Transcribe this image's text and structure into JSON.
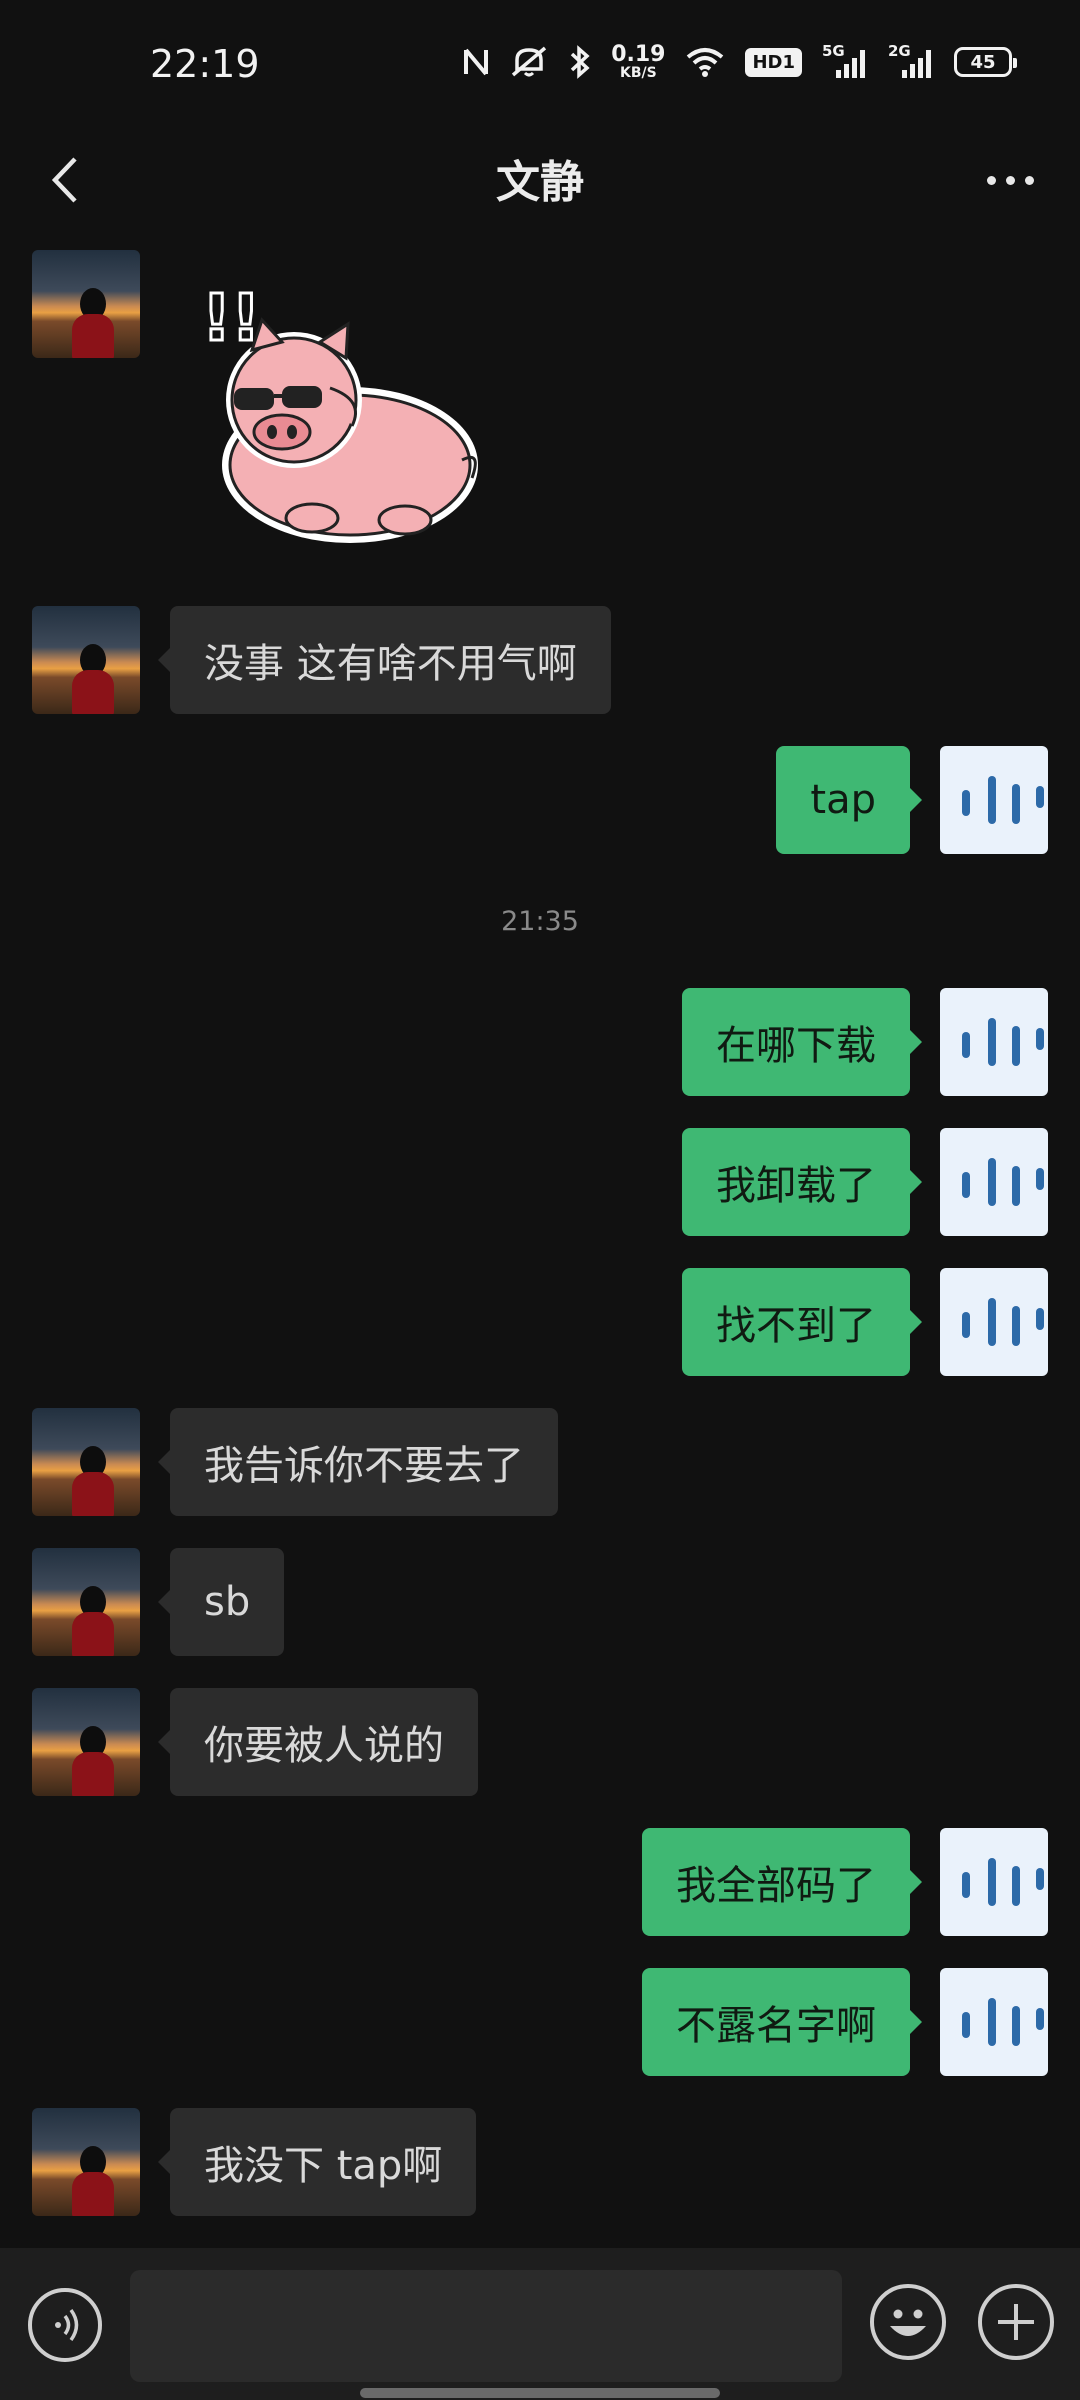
{
  "status_bar": {
    "time": "22:19",
    "net_speed_value": "0.19",
    "net_speed_unit": "KB/S",
    "hd_label": "HD1",
    "signal_1_label": "5G",
    "signal_2_label": "2G",
    "battery_level": "45"
  },
  "header": {
    "title": "文静",
    "icons": {
      "back": "chevron-left-icon",
      "more": "more-dots-icon"
    }
  },
  "colors": {
    "background": "#111111",
    "incoming_bubble": "#2c2c2c",
    "outgoing_bubble": "#3fb873",
    "input_bar": "#1e1e1e"
  },
  "messages": [
    {
      "sender": "contact",
      "type": "sticker",
      "sticker": "pig-sunglasses-sticker"
    },
    {
      "sender": "contact",
      "type": "text",
      "text": "没事 这有啥不用气啊"
    },
    {
      "sender": "me",
      "type": "text",
      "text": "tap"
    },
    {
      "type": "timestamp",
      "text": "21:35"
    },
    {
      "sender": "me",
      "type": "text",
      "text": "在哪下载"
    },
    {
      "sender": "me",
      "type": "text",
      "text": "我卸载了"
    },
    {
      "sender": "me",
      "type": "text",
      "text": "找不到了"
    },
    {
      "sender": "contact",
      "type": "text",
      "text": "我告诉你不要去了"
    },
    {
      "sender": "contact",
      "type": "text",
      "text": "sb"
    },
    {
      "sender": "contact",
      "type": "text",
      "text": "你要被人说的"
    },
    {
      "sender": "me",
      "type": "text",
      "text": "我全部码了"
    },
    {
      "sender": "me",
      "type": "text",
      "text": "不露名字啊"
    },
    {
      "sender": "contact",
      "type": "text",
      "text": "我没下 tap啊"
    }
  ],
  "input_bar": {
    "placeholder": "",
    "icons": {
      "voice": "voice-icon",
      "emoji": "emoji-icon",
      "more": "plus-icon"
    }
  }
}
